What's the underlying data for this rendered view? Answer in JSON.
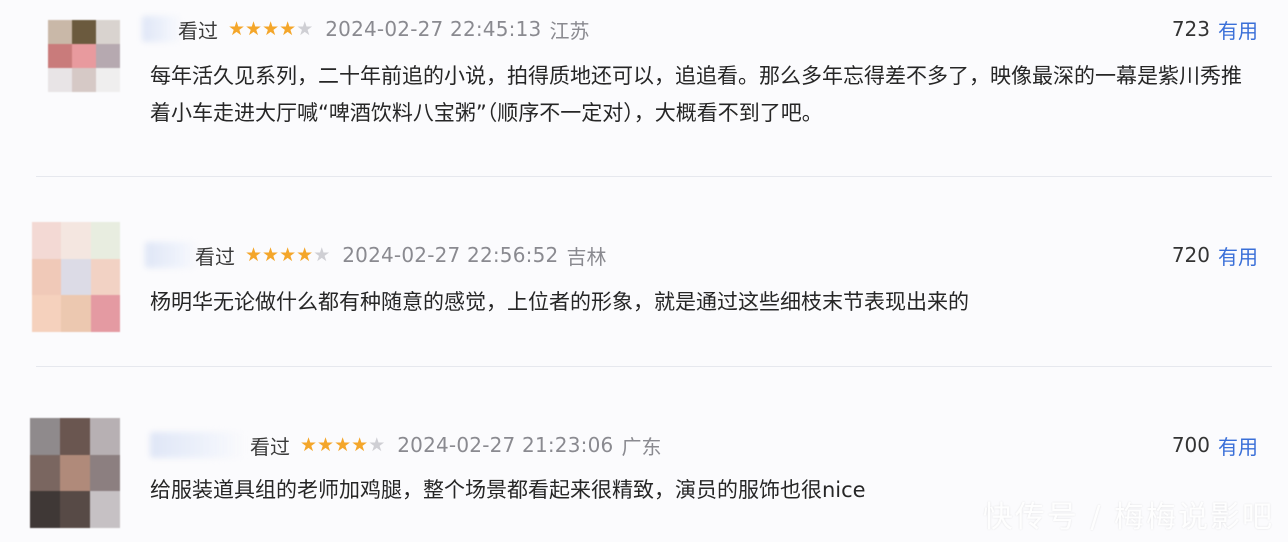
{
  "reviews": [
    {
      "watched": "看过",
      "rating": 4,
      "datetime": "2024-02-27 22:45:13",
      "region": "江苏",
      "useful_count": "723",
      "useful_label": "有用",
      "content": "每年活久见系列，二十年前追的小说，拍得质地还可以，追追看。那么多年忘得差不多了，映像最深的一幕是紫川秀推着小车走进大厅喊“啤酒饮料八宝粥”（顺序不一定对），大概看不到了吧。"
    },
    {
      "watched": "看过",
      "rating": 4,
      "datetime": "2024-02-27 22:56:52",
      "region": "吉林",
      "useful_count": "720",
      "useful_label": "有用",
      "content": "杨明华无论做什么都有种随意的感觉，上位者的形象，就是通过这些细枝末节表现出来的"
    },
    {
      "watched": "看过",
      "rating": 4,
      "datetime": "2024-02-27 21:23:06",
      "region": "广东",
      "useful_count": "700",
      "useful_label": "有用",
      "content": "给服装道具组的老师加鸡腿，整个场景都看起来很精致，演员的服饰也很nice"
    }
  ],
  "watermark": "快传号 / 梅梅说影吧",
  "colors": {
    "star_on": "#f4a62a",
    "star_off": "#cfcfd4",
    "useful_link": "#3a6fd8",
    "meta_gray": "#8a8a90"
  }
}
